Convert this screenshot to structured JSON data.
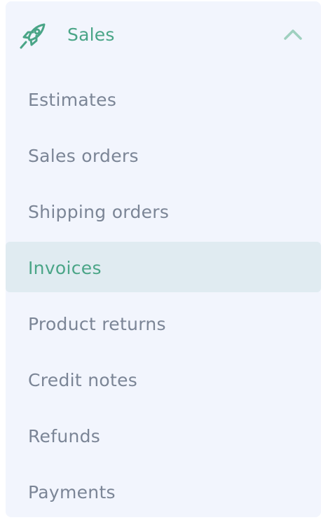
{
  "section": {
    "title": "Sales",
    "icon": "rocket-icon",
    "expanded": true,
    "toggle_icon": "chevron-up-icon",
    "accent_color": "#4aa587",
    "text_color": "#7b8596",
    "background_color": "#f2f5fd",
    "active_background_color": "#e0ebf1"
  },
  "menu": {
    "items": [
      {
        "label": "Estimates",
        "active": false
      },
      {
        "label": "Sales orders",
        "active": false
      },
      {
        "label": "Shipping orders",
        "active": false
      },
      {
        "label": "Invoices",
        "active": true
      },
      {
        "label": "Product returns",
        "active": false
      },
      {
        "label": "Credit notes",
        "active": false
      },
      {
        "label": "Refunds",
        "active": false
      },
      {
        "label": "Payments",
        "active": false
      }
    ]
  }
}
